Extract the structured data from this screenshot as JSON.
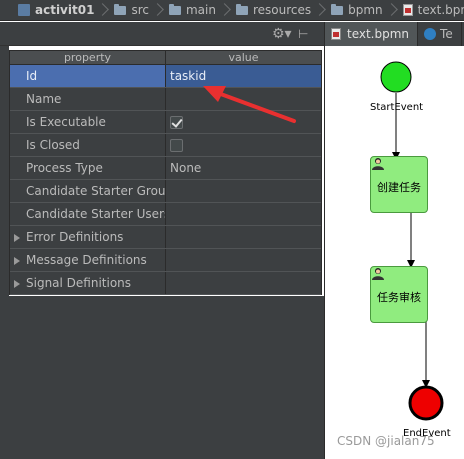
{
  "breadcrumbs": [
    {
      "label": "activit01",
      "icon": "project-icon",
      "bold": true
    },
    {
      "label": "src",
      "icon": "folder-icon"
    },
    {
      "label": "main",
      "icon": "folder-icon"
    },
    {
      "label": "resources",
      "icon": "folder-icon"
    },
    {
      "label": "bpmn",
      "icon": "folder-icon"
    },
    {
      "label": "text.bpmn",
      "icon": "bpmn-file-icon"
    }
  ],
  "toolbar": {
    "gear_icon": "gear-icon",
    "pin_icon": "pin-icon"
  },
  "properties": {
    "header": {
      "property": "property",
      "value": "value"
    },
    "rows": [
      {
        "name": "Id",
        "value": "taskid",
        "type": "text",
        "selected": true
      },
      {
        "name": "Name",
        "value": "",
        "type": "text"
      },
      {
        "name": "Is Executable",
        "value": "",
        "type": "checkbox",
        "checked": true
      },
      {
        "name": "Is Closed",
        "value": "",
        "type": "checkbox",
        "checked": false
      },
      {
        "name": "Process Type",
        "value": "None",
        "type": "text"
      },
      {
        "name": "Candidate Starter Group",
        "value": "",
        "type": "text"
      },
      {
        "name": "Candidate Starter Users",
        "value": "",
        "type": "text"
      },
      {
        "name": "Error Definitions",
        "value": "",
        "type": "group"
      },
      {
        "name": "Message Definitions",
        "value": "",
        "type": "group"
      },
      {
        "name": "Signal Definitions",
        "value": "",
        "type": "group"
      }
    ]
  },
  "tabs": [
    {
      "label": "text.bpmn",
      "active": true,
      "icon": "bpmn-file-icon"
    },
    {
      "label": "Te",
      "active": false,
      "icon": "class-icon"
    }
  ],
  "diagram": {
    "start_event": "StartEvent",
    "tasks": [
      "创建任务",
      "任务审核"
    ],
    "end_event": "EndEvent",
    "colors": {
      "start": "#22dd22",
      "task_fill": "#90ec7f",
      "end": "#ee0000"
    }
  },
  "watermark": "CSDN @jialan75",
  "colors": {
    "panel_bg": "#3c3f41",
    "selection": "#4b6eaf",
    "annotation_arrow": "#e83030"
  }
}
